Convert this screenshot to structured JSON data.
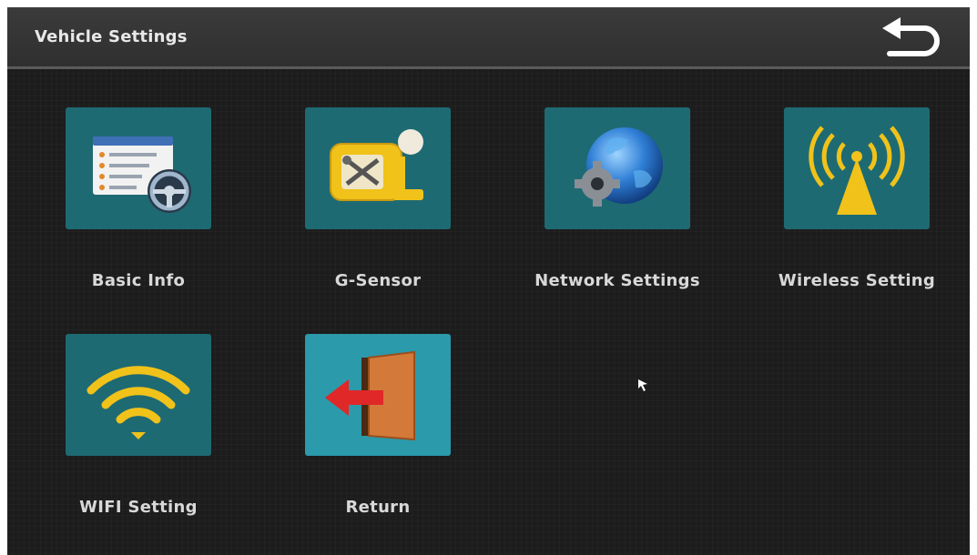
{
  "header": {
    "title": "Vehicle Settings",
    "back_icon": "undo-arrow-icon"
  },
  "menu": [
    {
      "label": "Basic Info",
      "icon": "info-list-steering-wheel-icon"
    },
    {
      "label": "G-Sensor",
      "icon": "sensor-tools-icon"
    },
    {
      "label": "Network Settings",
      "icon": "globe-gear-icon"
    },
    {
      "label": "Wireless Setting",
      "icon": "antenna-signal-icon"
    },
    {
      "label": "WIFI Setting",
      "icon": "wifi-icon"
    },
    {
      "label": "Return",
      "icon": "exit-door-icon"
    }
  ],
  "colors": {
    "background": "#1c1c1c",
    "header": "#353535",
    "tile": "#1e6a73",
    "label": "#d8d8d8"
  }
}
